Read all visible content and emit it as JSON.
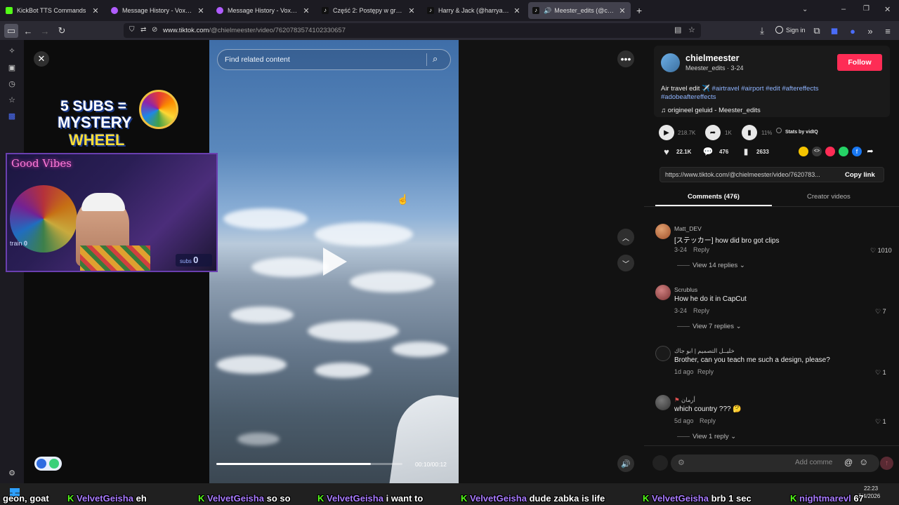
{
  "tabs": [
    {
      "title": "KickBot TTS Commands",
      "color": "#53fc18"
    },
    {
      "title": "Message History - VoxBot",
      "color": "#b05cff"
    },
    {
      "title": "Message History - VoxBot",
      "color": "#b05cff"
    },
    {
      "title": "Część 2: Postępy w grze w darts",
      "color": "#000000"
    },
    {
      "title": "Harry & Jack (@harryandjack_)",
      "color": "#000000"
    },
    {
      "title": "Meester_edits (@chielmeester",
      "color": "#000000"
    }
  ],
  "nav": {
    "url_host": "www.tiktok.com",
    "url_path": "/@chielmeester/video/7620783574102330657",
    "signin_label": "Sign in"
  },
  "stream_overlay": {
    "promo_line1": "5 SUBS =",
    "promo_line2": "MYSTERY",
    "promo_line3": "WHEEL",
    "neon_sign": "Good Vibes",
    "cam_label": "train",
    "cam_count": "0",
    "subs_label": "subs",
    "subs_count": "0"
  },
  "video": {
    "search_placeholder": "Find related content",
    "time": "00:10/00:12",
    "progress": 0.83
  },
  "author": {
    "display_name": "chielmeester",
    "handle_date": "Meester_edits · 3-24",
    "follow_label": "Follow",
    "caption": "Air travel edit ✈️",
    "hashtags_line1": "#airtravel #airport #edit #aftereffects",
    "hashtags_line2": "#adobeaftereffects",
    "sound": "origineel geluid - Meester_edits"
  },
  "stats": {
    "plays": "218.7K",
    "shares": "1K",
    "percent": "11%",
    "stats_by": "Stats by vidIQ",
    "likes": "22.1K",
    "comments": "476",
    "saves": "2633"
  },
  "link": {
    "url": "https://www.tiktok.com/@chielmeester/video/7620783...",
    "copy_label": "Copy link"
  },
  "tabs_panel": {
    "comments_tab": "Comments (476)",
    "creator_tab": "Creator videos"
  },
  "comments": [
    {
      "name": "Matt_DEV",
      "text": "[ステッカー] how did bro got clips",
      "date": "3-24",
      "reply": "Reply",
      "likes": "1010",
      "view_replies": "View 14 replies"
    },
    {
      "name": "Scrublus",
      "text": "How he do it in CapCut",
      "date": "3-24",
      "reply": "Reply",
      "likes": "7",
      "view_replies": "View 7 replies"
    },
    {
      "name": "خليــل التصميم | ابو جاك",
      "text": "Brother, can you teach me such a design, please?",
      "date": "1d ago",
      "reply": "Reply",
      "likes": "1"
    },
    {
      "name": "أرمان",
      "text": "which country ??? 🤔",
      "date": "5d ago",
      "reply": "Reply",
      "likes": "1",
      "view_replies": "View 1 reply"
    }
  ],
  "comment_input": {
    "placeholder": "Add comme"
  },
  "taskbar": {
    "time": "22:23",
    "date": "2/4/2026"
  },
  "ticker": [
    {
      "name": "",
      "text": "geon, goat"
    },
    {
      "name": "VelvetGeisha",
      "text": "eh"
    },
    {
      "name": "VelvetGeisha",
      "text": "so so"
    },
    {
      "name": "VelvetGeisha",
      "text": "i want to"
    },
    {
      "name": "VelvetGeisha",
      "text": "dude zabka is life"
    },
    {
      "name": "VelvetGeisha",
      "text": "brb 1 sec"
    },
    {
      "name": "nightmarevl",
      "text": "67"
    }
  ]
}
